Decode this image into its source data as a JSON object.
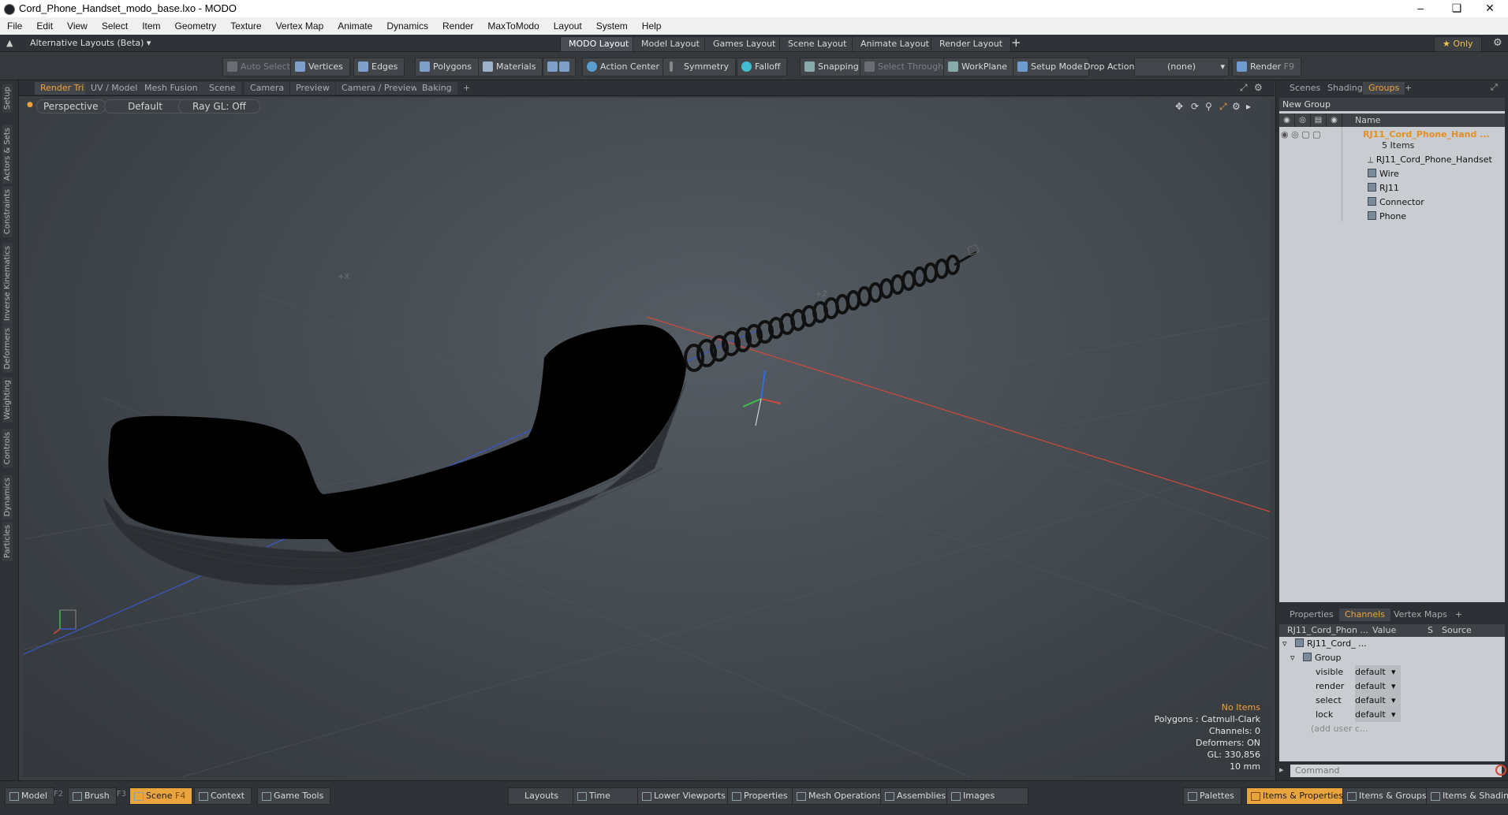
{
  "window": {
    "title": "Cord_Phone_Handset_modo_base.lxo - MODO",
    "controls": [
      "–",
      "❏",
      "✕"
    ]
  },
  "menu": [
    "File",
    "Edit",
    "View",
    "Select",
    "Item",
    "Geometry",
    "Texture",
    "Vertex Map",
    "Animate",
    "Dynamics",
    "Render",
    "MaxToModo",
    "Layout",
    "System",
    "Help"
  ],
  "layoutbar": {
    "alt_layouts": "Alternative Layouts (Beta) ▾",
    "tabs": [
      "MODO Layout",
      "Model Layout",
      "Games Layout",
      "Scene Layout",
      "Animate Layout",
      "Render Layout"
    ],
    "add": "+",
    "only": "★ Only"
  },
  "toolbar": {
    "auto_select": "Auto Select",
    "vertices": "Vertices",
    "edges": "Edges",
    "polygons": "Polygons",
    "materials": "Materials",
    "action_center": "Action Center",
    "symmetry": "Symmetry",
    "falloff": "Falloff",
    "snapping": "Snapping",
    "select_through": "Select Through",
    "workplane": "WorkPlane",
    "setup_mode": "Setup Mode",
    "drop_action_label": "Drop Action",
    "drop_action_value": "(none)",
    "render": "Render",
    "render_key": "F9"
  },
  "left_tabs": [
    "Setup",
    "Actors & Sets",
    "Constraints",
    "Inverse Kinematics",
    "Deformers",
    "Weighting",
    "Controls",
    "Dynamics",
    "Particles"
  ],
  "viewport_tabs": [
    "Render Tri",
    "UV / Model",
    "Mesh Fusion",
    "Scene",
    "Camera",
    "Preview",
    "Camera / Preview",
    "Baking",
    "+"
  ],
  "viewport": {
    "projection": "Perspective",
    "style": "Default",
    "raygl": "Ray GL: Off",
    "axis_labels": {
      "x": "+X",
      "z": "+Z"
    }
  },
  "stats": {
    "items": "No Items",
    "polygons": "Polygons : Catmull-Clark",
    "channels": "Channels: 0",
    "deformers": "Deformers: ON",
    "gl": "GL: 330,856",
    "unit": "10 mm"
  },
  "groups_panel": {
    "tabs": [
      "Scenes",
      "Shading",
      "Groups",
      "+"
    ],
    "new_group": "New Group",
    "name_header": "Name",
    "group_name": "RJ11_Cord_Phone_Hand ...",
    "item_count": "5 Items",
    "items": [
      "RJ11_Cord_Phone_Handset",
      "Wire",
      "RJ11",
      "Connector",
      "Phone"
    ]
  },
  "channels_panel": {
    "tabs": [
      "Properties",
      "Channels",
      "Vertex Maps",
      "+"
    ],
    "headers": [
      "RJ11_Cord_Phon ...",
      "Value",
      "S",
      "Source"
    ],
    "root": "RJ11_Cord_ ...",
    "group": "Group",
    "rows": [
      {
        "name": "visible",
        "value": "default"
      },
      {
        "name": "render",
        "value": "default"
      },
      {
        "name": "select",
        "value": "default"
      },
      {
        "name": "lock",
        "value": "default"
      }
    ],
    "add_user": "(add user c..."
  },
  "command": {
    "placeholder": "Command"
  },
  "bottombar": {
    "left": [
      {
        "label": "Model",
        "key": "F2"
      },
      {
        "label": "Brush",
        "key": "F3"
      },
      {
        "label": "Scene",
        "key": "F4"
      },
      {
        "label": "Context",
        "key": ""
      },
      {
        "label": "Game Tools",
        "key": ""
      }
    ],
    "middle": [
      "Layouts",
      "Time",
      "Lower Viewports",
      "Properties",
      "Mesh Operations",
      "Assemblies",
      "Images"
    ],
    "right": [
      "Palettes",
      "Items & Properties",
      "Items & Groups",
      "Items & Shading"
    ]
  },
  "colors": {
    "accent": "#f0a13c",
    "viewport": "#4b5157",
    "panel": "#c9ccd0"
  }
}
